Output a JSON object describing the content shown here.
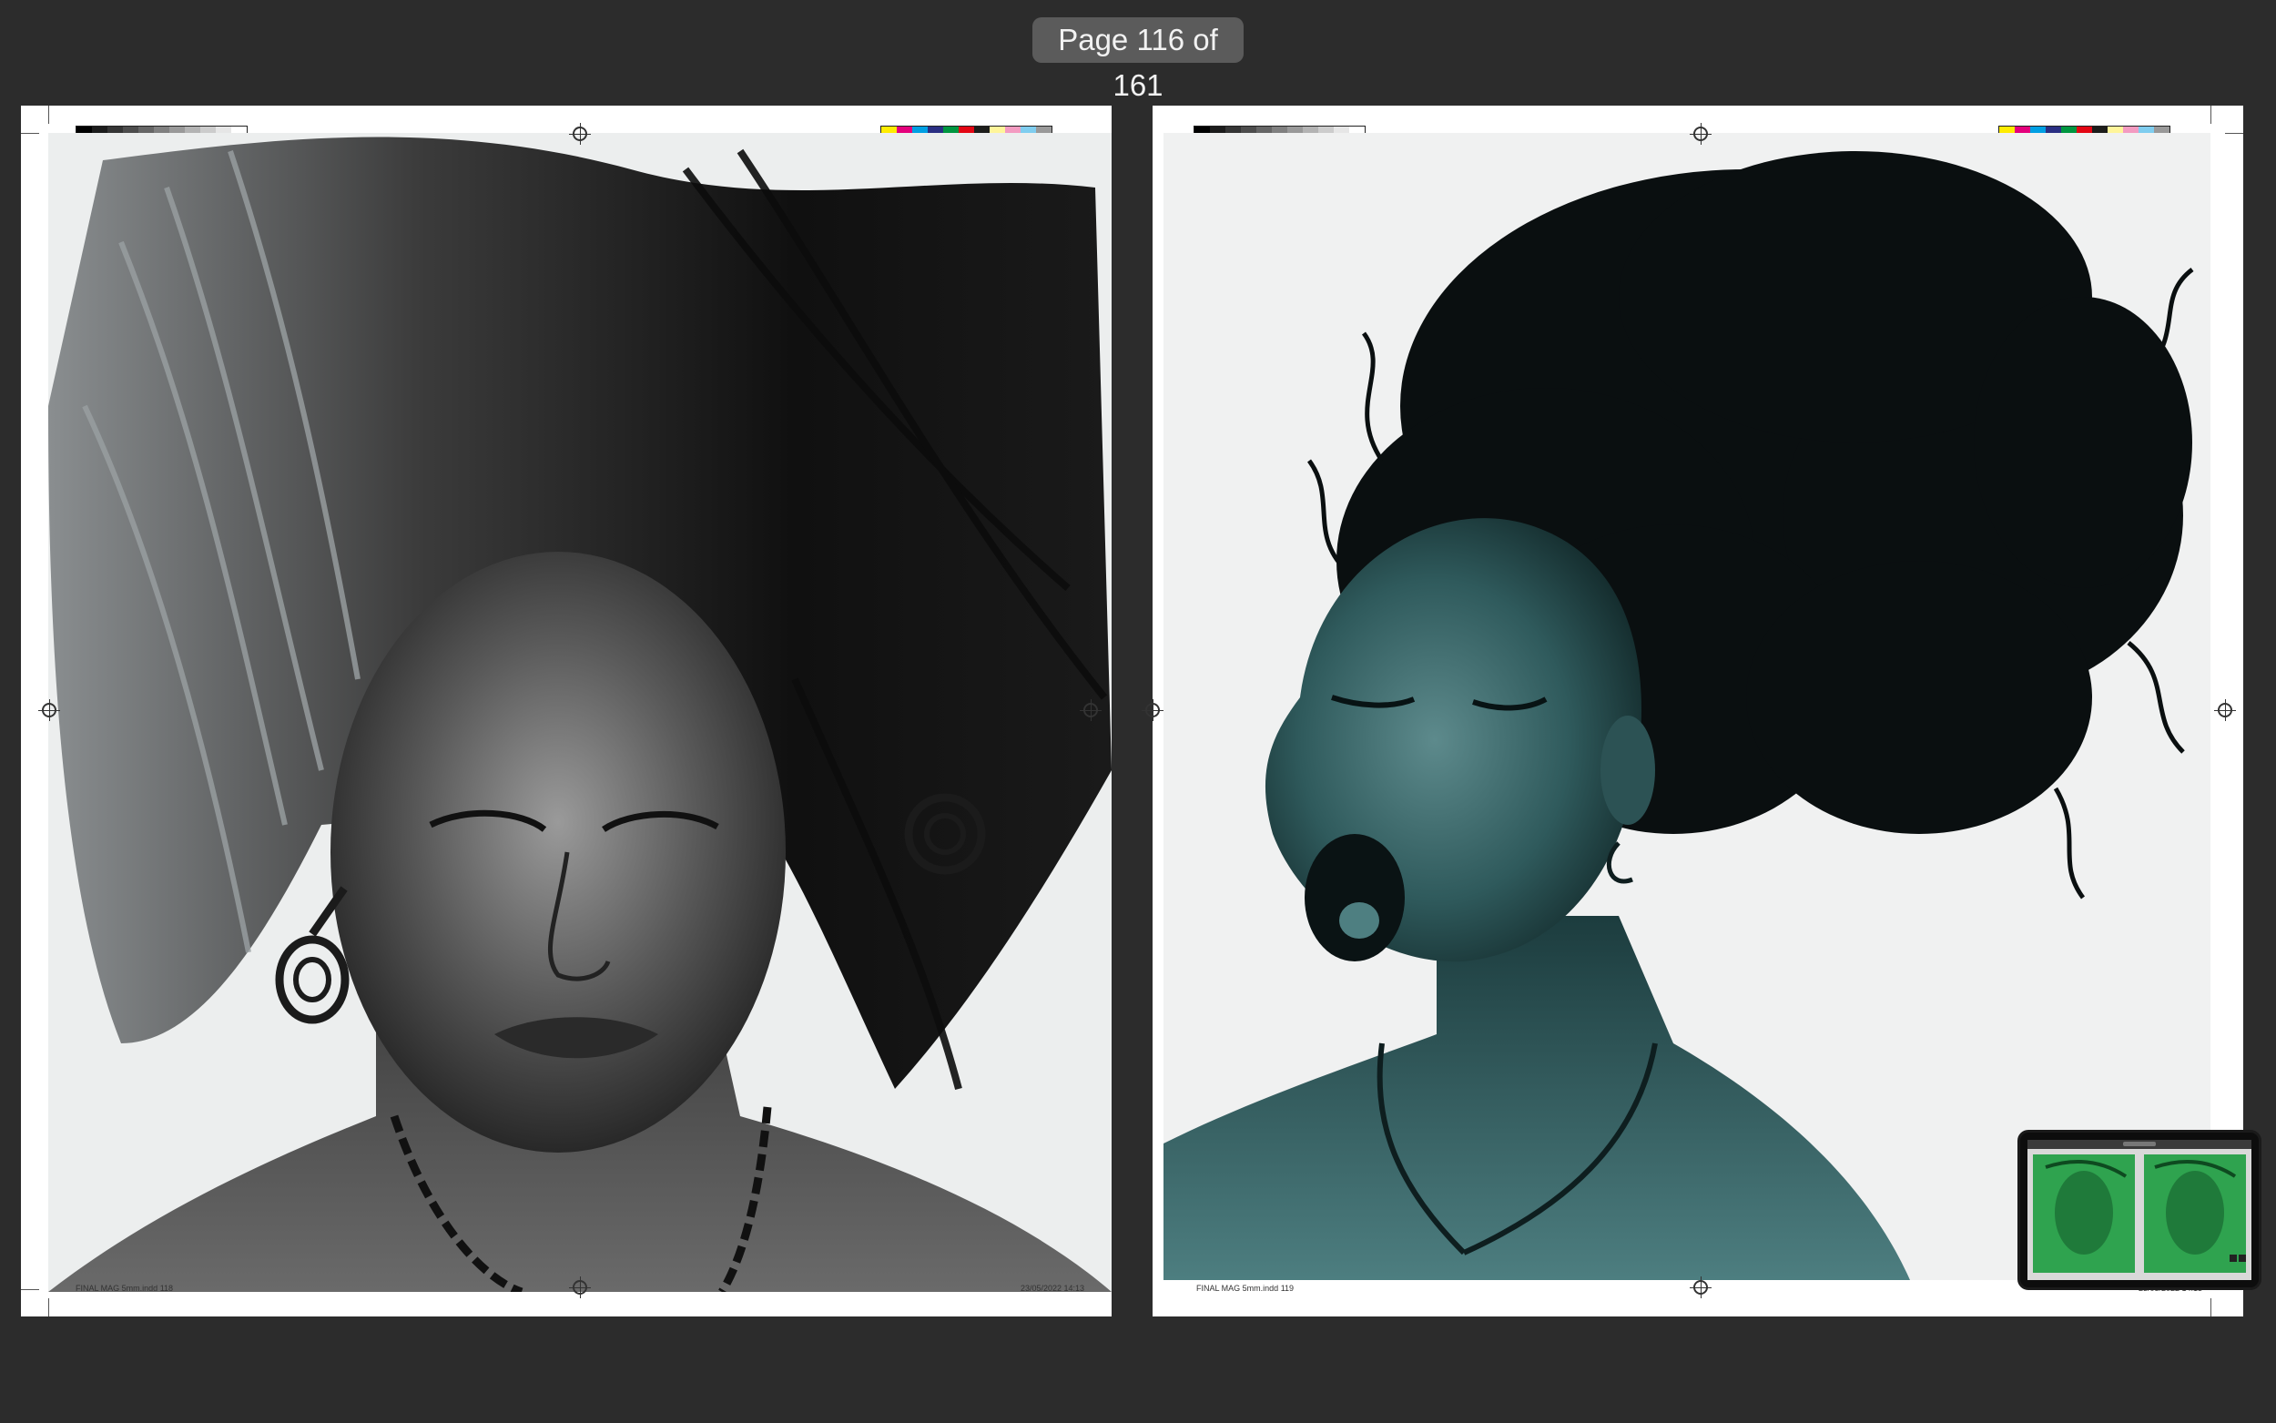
{
  "viewer": {
    "page_indicator": "Page 116 of 161"
  },
  "spread": {
    "left": {
      "footer_left": "FINAL MAG 5mm.indd   118",
      "footer_right": "23/05/2022   14:13"
    },
    "right": {
      "footer_left": "FINAL MAG 5mm.indd   119",
      "footer_right": "23/05/2022   14:13"
    }
  },
  "colors": {
    "background": "#2c2c2c",
    "indicator_bg": "#5b5b5b",
    "right_page_tint": "#2f5a5c",
    "thumbnail_tint": "#2fa34f"
  }
}
